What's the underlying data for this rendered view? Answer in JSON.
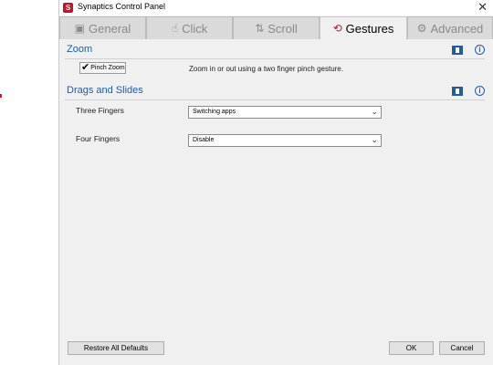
{
  "window": {
    "title": "Synaptics Control Panel",
    "close_glyph": "✕",
    "app_icon_letter": "S"
  },
  "tabs": [
    {
      "label": "General",
      "icon": "general-icon",
      "glyph": "▣",
      "active": false
    },
    {
      "label": "Click",
      "icon": "click-icon",
      "glyph": "☝",
      "active": false
    },
    {
      "label": "Scroll",
      "icon": "scroll-icon",
      "glyph": "⇅",
      "active": false
    },
    {
      "label": "Gestures",
      "icon": "gestures-icon",
      "glyph": "⟲",
      "active": true
    },
    {
      "label": "Advanced",
      "icon": "advanced-icon",
      "glyph": "⚙",
      "active": false
    }
  ],
  "sections": {
    "zoom": {
      "title": "Zoom",
      "checkbox_label": "Pinch Zoom",
      "checked": true,
      "description": "Zoom in or out using a two finger pinch gesture."
    },
    "drags": {
      "title": "Drags and Slides",
      "three_fingers_label": "Three Fingers",
      "three_fingers_value": "Switching apps",
      "four_fingers_label": "Four Fingers",
      "four_fingers_value": "Disable"
    }
  },
  "buttons": {
    "restore": "Restore All Defaults",
    "ok": "OK",
    "cancel": "Cancel"
  },
  "glyphs": {
    "check": "✔",
    "chevron": "⌄",
    "info": "i"
  },
  "colors": {
    "accent": "#c8102e",
    "section_title": "#1f5da3"
  }
}
